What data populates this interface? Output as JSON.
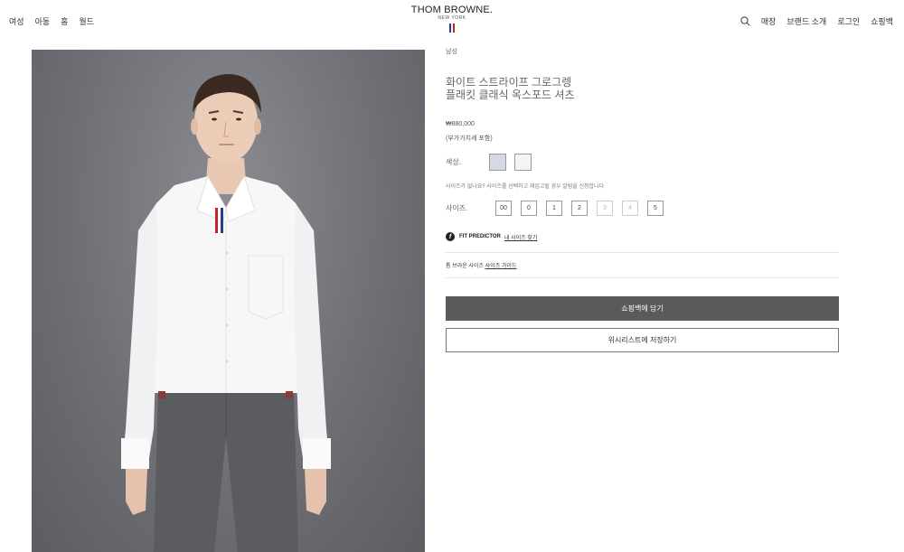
{
  "nav": {
    "left": [
      "여성",
      "아동",
      "홈",
      "월드"
    ],
    "right": [
      "매장",
      "브랜드 소개",
      "로그인",
      "쇼핑백"
    ]
  },
  "brand": {
    "name": "THOM BROWNE.",
    "sub": "NEW YORK",
    "flag_colors": [
      "#2d3a8c",
      "#ffffff",
      "#c8202f"
    ]
  },
  "product": {
    "category": "남성",
    "title_line1": "화이트 스트라이프 그로그렝",
    "title_line2": "플래킷 클래식 옥스포드 셔츠",
    "price": "₩880,000",
    "vat_note": "(부가가치세 포함)",
    "color_label": "색상.",
    "colors": [
      "#d6d9e3",
      "#f4f4f4"
    ],
    "size_note": "사이즈가 없나요? 사이즈를 선택하고 재입고될 경우 알림을 신청합니다",
    "size_label": "사이즈.",
    "sizes": [
      {
        "label": "00",
        "available": true
      },
      {
        "label": "0",
        "available": true
      },
      {
        "label": "1",
        "available": true
      },
      {
        "label": "2",
        "available": true
      },
      {
        "label": "3",
        "available": false
      },
      {
        "label": "4",
        "available": false
      },
      {
        "label": "5",
        "available": true
      }
    ],
    "fit_predictor": "FIT PREDICTOR",
    "fit_link": "내 사이즈 찾기",
    "guide_prefix": "톰 브라운 사이즈",
    "guide_link": "사이즈 가이드",
    "add_to_bag": "쇼핑백에 담기",
    "wishlist": "위시리스트에 저장하기"
  }
}
